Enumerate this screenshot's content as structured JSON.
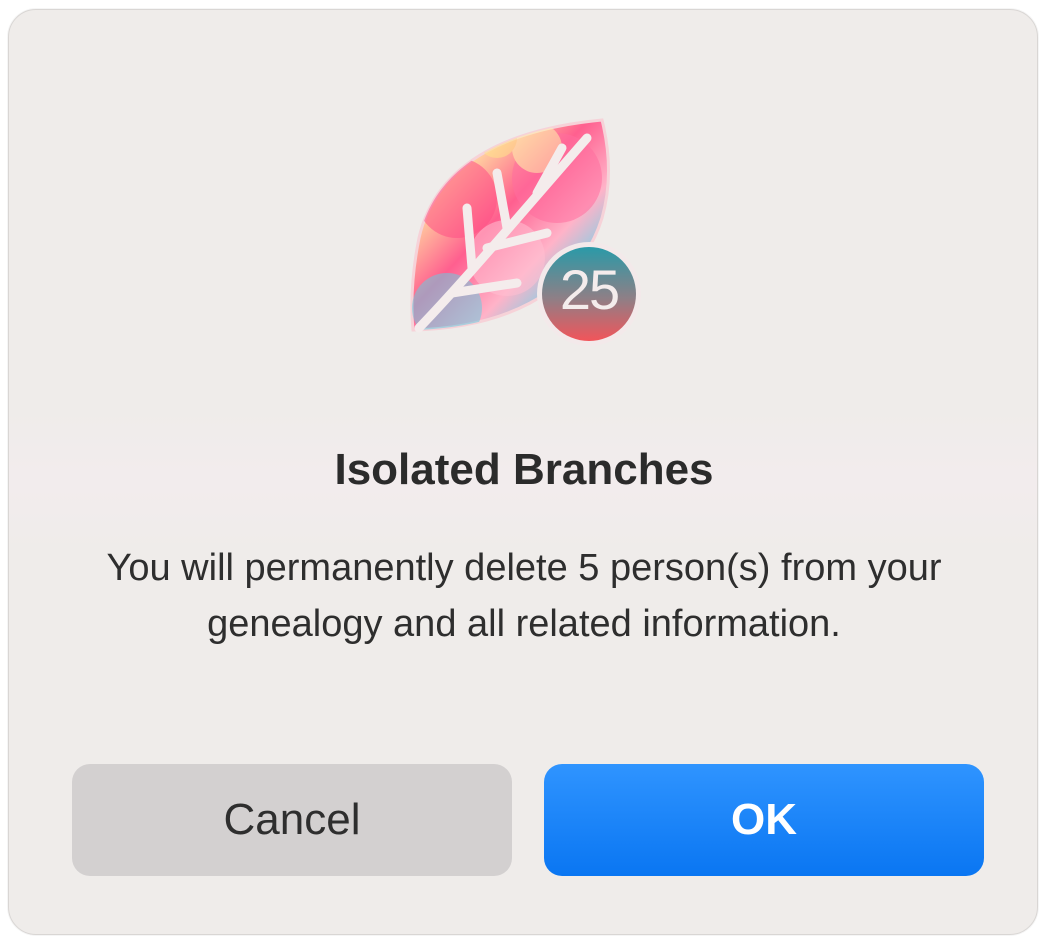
{
  "dialog": {
    "badge_number": "25",
    "title": "Isolated Branches",
    "message": "You will permanently delete 5 person(s) from your genealogy and all related information.",
    "cancel_label": "Cancel",
    "ok_label": "OK"
  },
  "colors": {
    "dialog_background": "#efecea",
    "ok_button": "#0a76f2",
    "cancel_button": "#d3d0d0",
    "title_text": "#2b2b2b"
  },
  "icons": {
    "app": "leaf-app-icon",
    "badge": "version-badge-icon"
  }
}
